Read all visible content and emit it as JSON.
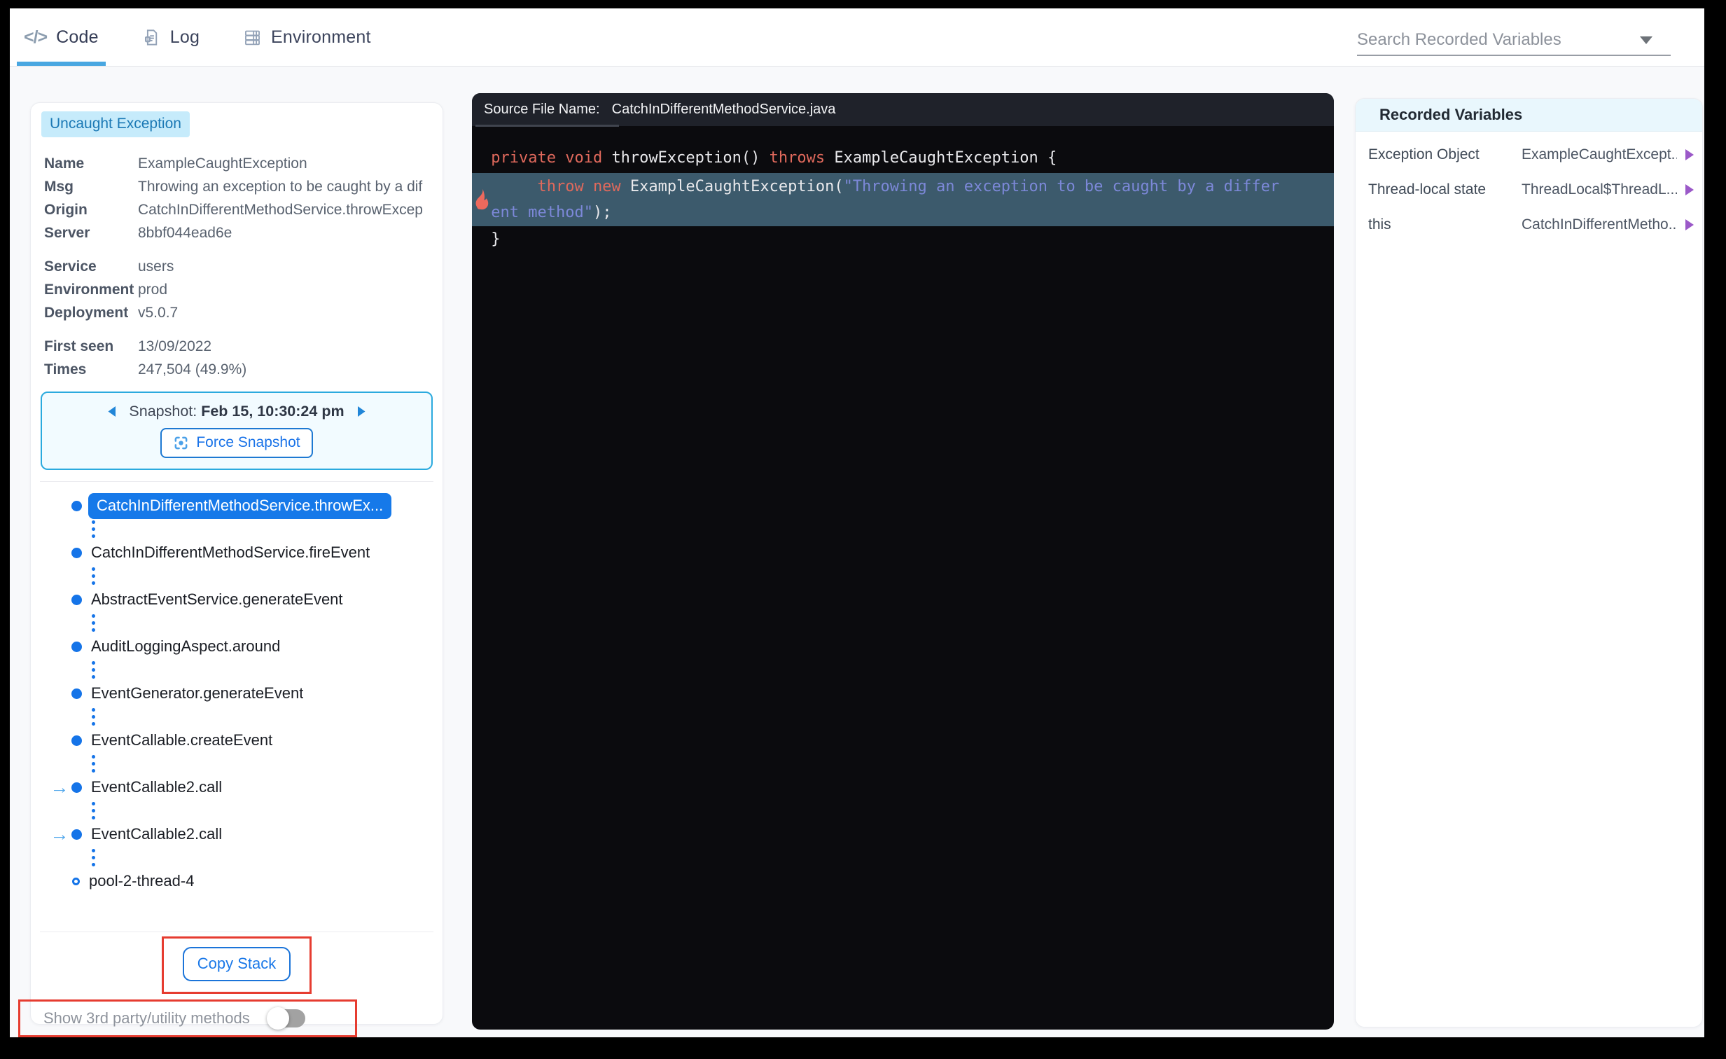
{
  "colors": {
    "accent_blue": "#1574e8",
    "sky_blue": "#49a7e1",
    "badge_bg": "#c6ebfb",
    "badge_text": "#1b79b5",
    "snapshot_border": "#2baade",
    "annotation_red": "#e63c30",
    "code_highlight_row": "#3c5a6c",
    "code_keyword": "#e0695c",
    "code_string": "#7c88d8",
    "purple_caret": "#9b59c8",
    "selected_chip_bg": "#1679e9"
  },
  "topbar": {
    "tabs": [
      {
        "label": "Code",
        "icon": "code-icon",
        "active": true
      },
      {
        "label": "Log",
        "icon": "log-icon",
        "active": false
      },
      {
        "label": "Environment",
        "icon": "environment-icon",
        "active": false
      }
    ],
    "search_label": "Search Recorded Variables"
  },
  "exception_panel": {
    "badge": "Uncaught Exception",
    "groups": [
      {
        "rows": [
          {
            "label": "Name",
            "value": "ExampleCaughtException"
          },
          {
            "label": "Msg",
            "value": "Throwing an exception to be caught by a dif"
          },
          {
            "label": "Origin",
            "value": "CatchInDifferentMethodService.throwExcep"
          },
          {
            "label": "Server",
            "value": "8bbf044ead6e"
          }
        ]
      },
      {
        "rows": [
          {
            "label": "Service",
            "value": "users"
          },
          {
            "label": "Environment",
            "value": "prod"
          },
          {
            "label": "Deployment",
            "value": "v5.0.7"
          }
        ]
      },
      {
        "rows": [
          {
            "label": "First seen",
            "value": "13/09/2022"
          },
          {
            "label": "Times",
            "value": "247,504 (49.9%)"
          }
        ]
      }
    ]
  },
  "snapshot": {
    "label": "Snapshot:",
    "value": "Feb 15, 10:30:24 pm",
    "force_button": "Force Snapshot"
  },
  "stack": {
    "items": [
      {
        "label": "CatchInDifferentMethodService.throwEx...",
        "selected": true,
        "marker": "filled",
        "arrow": false
      },
      {
        "label": "CatchInDifferentMethodService.fireEvent",
        "selected": false,
        "marker": "filled",
        "arrow": false
      },
      {
        "label": "AbstractEventService.generateEvent",
        "selected": false,
        "marker": "filled",
        "arrow": false
      },
      {
        "label": "AuditLoggingAspect.around",
        "selected": false,
        "marker": "filled",
        "arrow": false
      },
      {
        "label": "EventGenerator.generateEvent",
        "selected": false,
        "marker": "filled",
        "arrow": false
      },
      {
        "label": "EventCallable.createEvent",
        "selected": false,
        "marker": "filled",
        "arrow": false
      },
      {
        "label": "EventCallable2.call",
        "selected": false,
        "marker": "filled",
        "arrow": true
      },
      {
        "label": "EventCallable2.call",
        "selected": false,
        "marker": "filled",
        "arrow": true
      },
      {
        "label": "pool-2-thread-4",
        "selected": false,
        "marker": "open",
        "arrow": false
      }
    ],
    "copy_button": "Copy Stack",
    "toggle_label": "Show 3rd party/utility methods",
    "toggle_on": false
  },
  "code_panel": {
    "header_label": "Source File Name:",
    "file_name": "CatchInDifferentMethodService.java",
    "lines": [
      {
        "highlight": false,
        "flame": false,
        "rows": [
          [
            {
              "c": "k",
              "t": " private void "
            },
            {
              "c": "p",
              "t": "throwException() "
            },
            {
              "c": "k",
              "t": "throws "
            },
            {
              "c": "p",
              "t": "ExampleCaughtException {"
            }
          ]
        ]
      },
      {
        "highlight": true,
        "flame": true,
        "rows": [
          [
            {
              "c": "k",
              "t": "      throw new "
            },
            {
              "c": "p",
              "t": "ExampleCaughtException("
            },
            {
              "c": "s",
              "t": "\"Throwing an exception to be caught by a differ"
            }
          ],
          [
            {
              "c": "s",
              "t": " ent method\""
            },
            {
              "c": "p",
              "t": ");"
            }
          ]
        ]
      },
      {
        "highlight": false,
        "flame": false,
        "rows": [
          [
            {
              "c": "p",
              "t": " }"
            }
          ]
        ]
      }
    ]
  },
  "recorded_variables": {
    "title": "Recorded Variables",
    "rows": [
      {
        "name": "Exception Object",
        "value": "ExampleCaughtExcept..."
      },
      {
        "name": "Thread-local state",
        "value": "ThreadLocal$ThreadL..."
      },
      {
        "name": "this",
        "value": "CatchInDifferentMetho..."
      }
    ]
  }
}
